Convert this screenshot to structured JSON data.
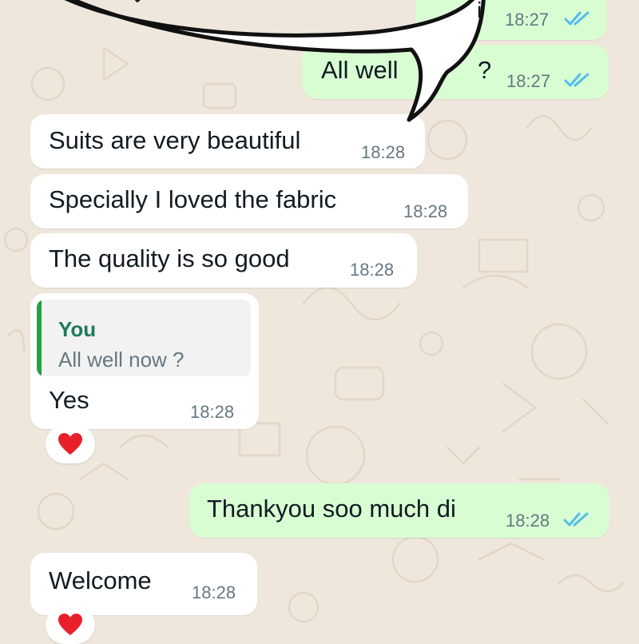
{
  "colors": {
    "wallpaper": "#efe7dc",
    "incoming_bubble": "#ffffff",
    "outgoing_bubble": "#d9fdd3",
    "read_ticks": "#53bdeb",
    "reply_accent": "#25a244",
    "heart": "#e8202c"
  },
  "messages": [
    {
      "direction": "outgoing",
      "text": "",
      "time": "18:27",
      "status": "read",
      "partially_hidden": true
    },
    {
      "direction": "outgoing",
      "text": "All well",
      "text_tail": "?",
      "time": "18:27",
      "status": "read",
      "partially_hidden": true
    },
    {
      "direction": "incoming",
      "text": "Suits are very beautiful",
      "time": "18:28"
    },
    {
      "direction": "incoming",
      "text": "Specially I loved the fabric",
      "time": "18:28"
    },
    {
      "direction": "incoming",
      "text": "The quality is so good",
      "time": "18:28"
    },
    {
      "direction": "incoming",
      "reply_to": {
        "author": "You",
        "text": "All well now ?"
      },
      "text": "Yes",
      "time": "18:28",
      "reaction": "heart-icon"
    },
    {
      "direction": "outgoing",
      "text": "Thankyou soo much di",
      "time": "18:28",
      "status": "read"
    },
    {
      "direction": "incoming",
      "text": "Welcome",
      "time": "18:28",
      "reaction": "heart-icon"
    }
  ],
  "overlay": {
    "type": "speech-bubble-sticker",
    "fragment_text": "i"
  }
}
